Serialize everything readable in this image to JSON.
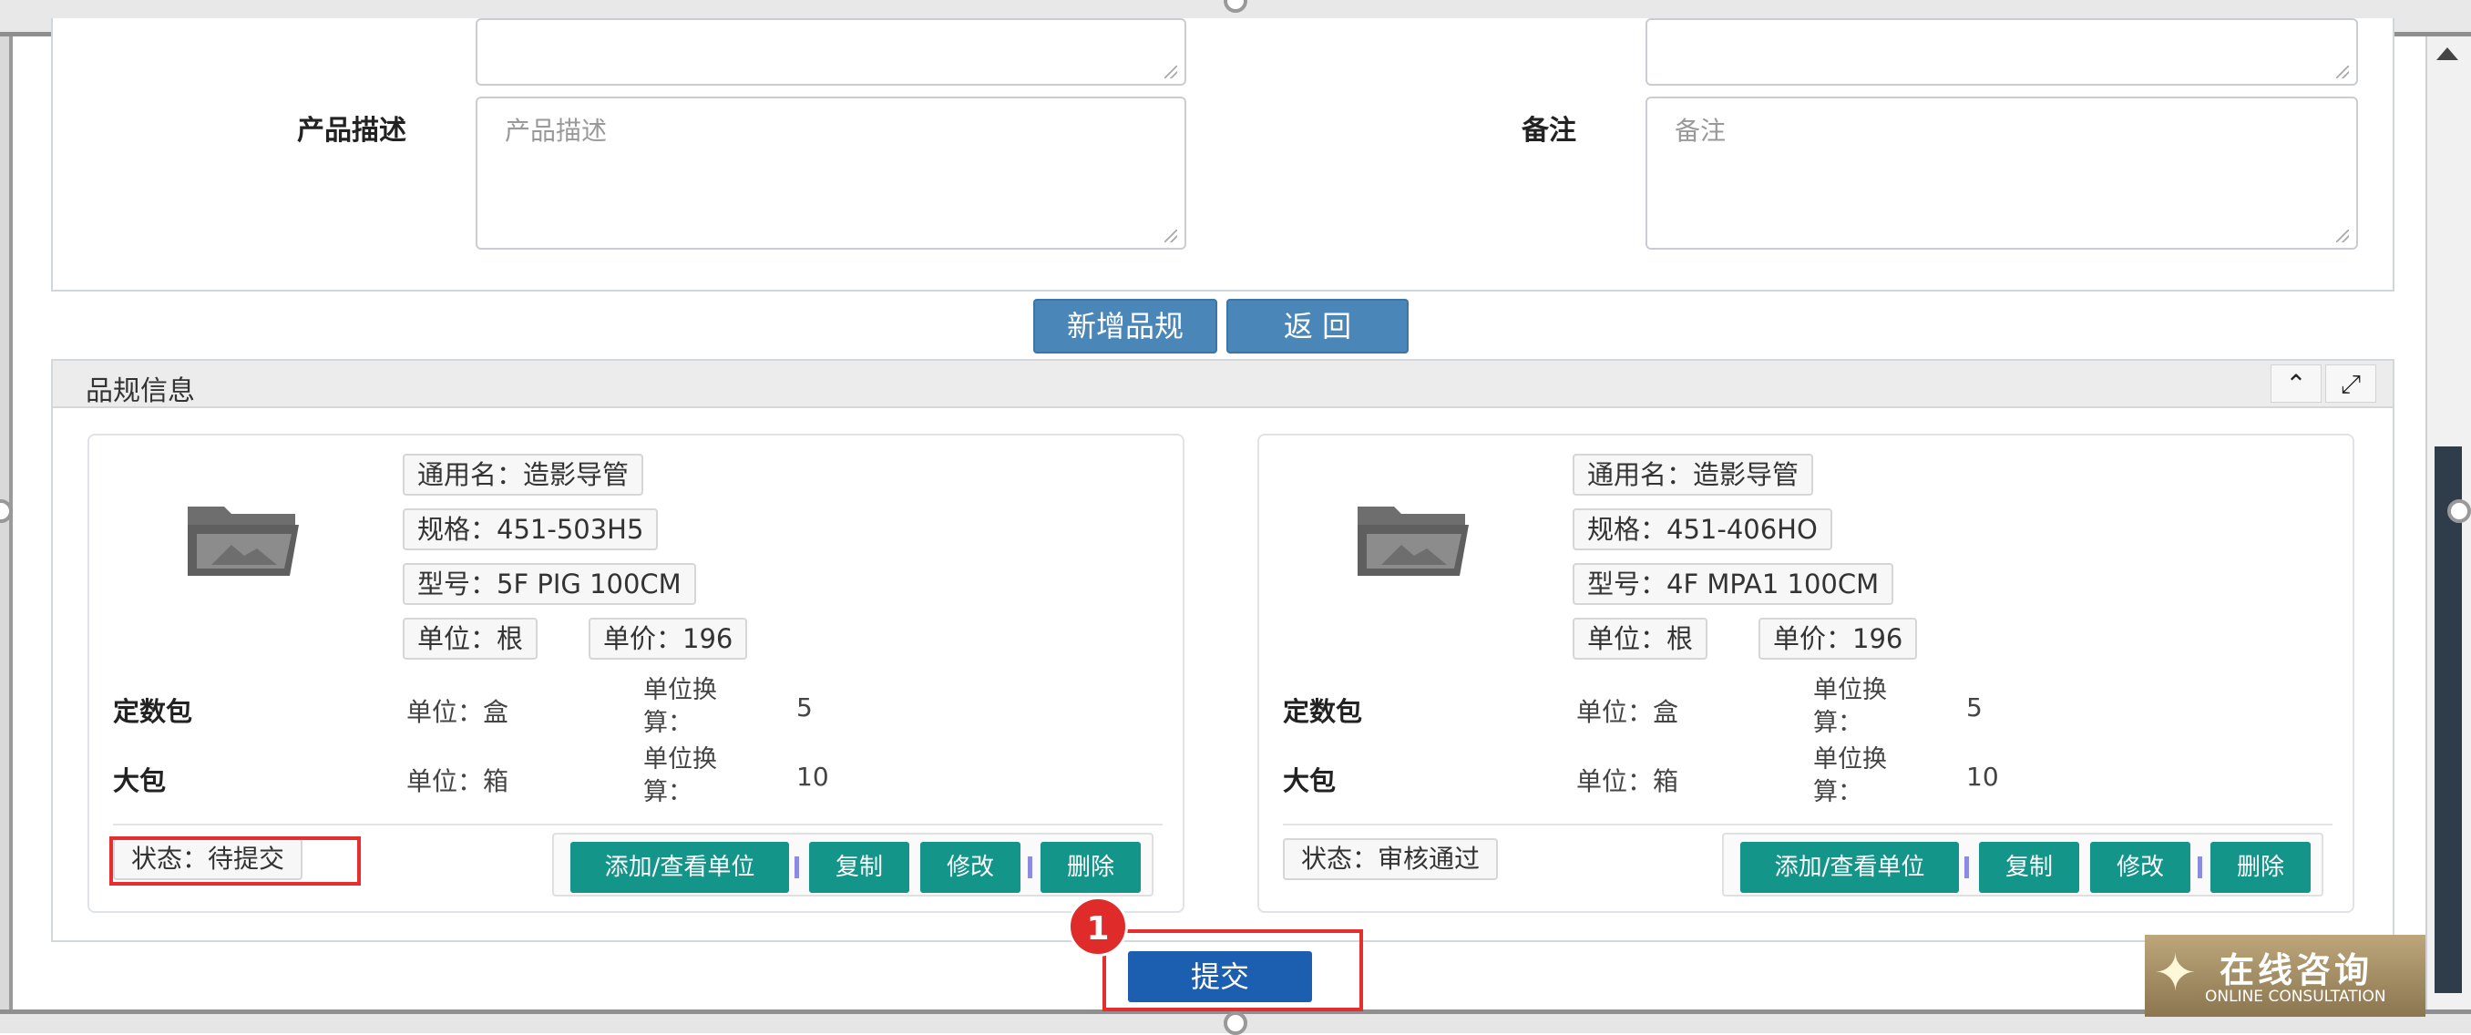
{
  "form": {
    "product_desc_label": "产品描述",
    "product_desc_placeholder": "产品描述",
    "remark_label": "备注",
    "remark_placeholder": "备注"
  },
  "buttons": {
    "add_spec": "新增品规",
    "back": "返 回",
    "submit": "提交"
  },
  "spec_panel": {
    "title": "品规信息",
    "collapse_icon": "chevron-up-icon",
    "expand_icon": "expand-icon",
    "cards": [
      {
        "generic_name": "通用名：造影导管",
        "spec": "规格：451-503H5",
        "model": "型号：5F PIG 100CM",
        "unit": "单位：根",
        "price": "单价：196",
        "packages": [
          {
            "label": "定数包",
            "unit": "单位：盒",
            "conv_label": "单位换算：",
            "conv_value": "5"
          },
          {
            "label": "大包",
            "unit": "单位：箱",
            "conv_label": "单位换算：",
            "conv_value": "10"
          }
        ],
        "status": "状态：待提交",
        "actions": {
          "add_view_unit": "添加/查看单位",
          "copy": "复制",
          "edit": "修改",
          "delete": "删除"
        }
      },
      {
        "generic_name": "通用名：造影导管",
        "spec": "规格：451-406HO",
        "model": "型号：4F MPA1 100CM",
        "unit": "单位：根",
        "price": "单价：196",
        "packages": [
          {
            "label": "定数包",
            "unit": "单位：盒",
            "conv_label": "单位换算：",
            "conv_value": "5"
          },
          {
            "label": "大包",
            "unit": "单位：箱",
            "conv_label": "单位换算：",
            "conv_value": "10"
          }
        ],
        "status": "状态：审核通过",
        "actions": {
          "add_view_unit": "添加/查看单位",
          "copy": "复制",
          "edit": "修改",
          "delete": "删除"
        }
      }
    ]
  },
  "annotation": {
    "step": "1"
  },
  "consult_widget": {
    "cn": "在线咨询",
    "en": "ONLINE CONSULTATION"
  },
  "colors": {
    "blue_button": "#4a87b8",
    "teal_button": "#13958a",
    "submit": "#1c5fb0",
    "highlight": "#e62e2e"
  }
}
